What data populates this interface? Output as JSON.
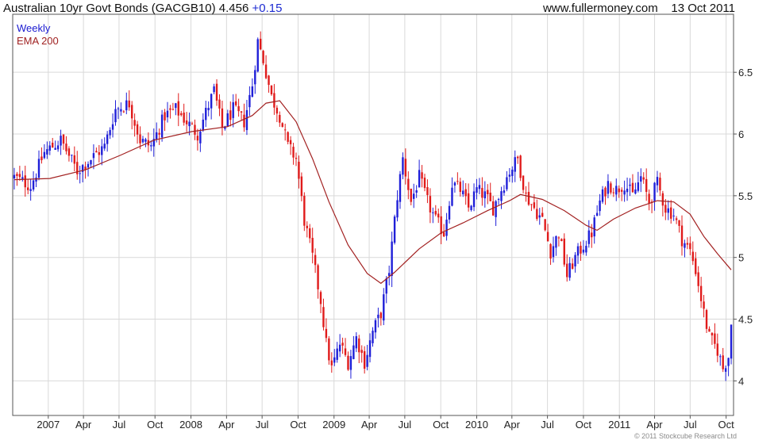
{
  "header": {
    "instrument": "Australian 10yr Govt Bonds (GACGB10)",
    "last": "4.456",
    "change": "+0.15",
    "source": "www.fullermoney.com",
    "date": "13 Oct 2011"
  },
  "legend": {
    "period": "Weekly",
    "ema": "EMA 200"
  },
  "copyright": "© 2011 Stockcube Research Ltd",
  "colors": {
    "up": "#1f1fd8",
    "down": "#e01b1b",
    "ema": "#a22020",
    "grid": "#d9d9d9",
    "frame": "#555555"
  },
  "chart_data": {
    "type": "candlestick",
    "period": "weekly",
    "y_ticks": [
      "4",
      "4.5",
      "5",
      "5.5",
      "6",
      "6.5"
    ],
    "ylim": [
      3.72,
      6.97
    ],
    "x_range": [
      "2006-10-02",
      "2011-10-20"
    ],
    "x_ticks": [
      {
        "date": "2007-01-01",
        "label": "2007"
      },
      {
        "date": "2007-04-01",
        "label": "Apr"
      },
      {
        "date": "2007-07-01",
        "label": "Jul"
      },
      {
        "date": "2007-10-01",
        "label": "Oct"
      },
      {
        "date": "2008-01-01",
        "label": "2008"
      },
      {
        "date": "2008-04-01",
        "label": "Apr"
      },
      {
        "date": "2008-07-01",
        "label": "Jul"
      },
      {
        "date": "2008-10-01",
        "label": "Oct"
      },
      {
        "date": "2009-01-01",
        "label": "2009"
      },
      {
        "date": "2009-04-01",
        "label": "Apr"
      },
      {
        "date": "2009-07-01",
        "label": "Jul"
      },
      {
        "date": "2009-10-01",
        "label": "Oct"
      },
      {
        "date": "2010-01-01",
        "label": "2010"
      },
      {
        "date": "2010-04-01",
        "label": "Apr"
      },
      {
        "date": "2010-07-01",
        "label": "Jul"
      },
      {
        "date": "2010-10-01",
        "label": "Oct"
      },
      {
        "date": "2011-01-01",
        "label": "2011"
      },
      {
        "date": "2011-04-01",
        "label": "Apr"
      },
      {
        "date": "2011-07-01",
        "label": "Jul"
      },
      {
        "date": "2011-10-01",
        "label": "Oct"
      }
    ],
    "close_path": [
      [
        "2006-10-06",
        5.65
      ],
      [
        "2006-11-17",
        5.58
      ],
      [
        "2006-12-22",
        5.85
      ],
      [
        "2007-02-02",
        5.95
      ],
      [
        "2007-03-16",
        5.7
      ],
      [
        "2007-04-20",
        5.8
      ],
      [
        "2007-05-25",
        5.9
      ],
      [
        "2007-06-22",
        6.2
      ],
      [
        "2007-07-27",
        6.25
      ],
      [
        "2007-08-24",
        5.95
      ],
      [
        "2007-09-21",
        5.9
      ],
      [
        "2007-10-26",
        6.15
      ],
      [
        "2007-11-23",
        6.2
      ],
      [
        "2007-12-21",
        6.1
      ],
      [
        "2008-01-18",
        6.0
      ],
      [
        "2008-02-29",
        6.35
      ],
      [
        "2008-03-21",
        6.05
      ],
      [
        "2008-04-18",
        6.2
      ],
      [
        "2008-05-16",
        6.1
      ],
      [
        "2008-06-06",
        6.4
      ],
      [
        "2008-06-20",
        6.75
      ],
      [
        "2008-07-04",
        6.6
      ],
      [
        "2008-07-25",
        6.3
      ],
      [
        "2008-08-15",
        6.15
      ],
      [
        "2008-09-05",
        5.9
      ],
      [
        "2008-09-26",
        5.8
      ],
      [
        "2008-10-17",
        5.3
      ],
      [
        "2008-11-07",
        5.0
      ],
      [
        "2008-11-28",
        4.65
      ],
      [
        "2008-12-12",
        4.3
      ],
      [
        "2008-12-26",
        4.1
      ],
      [
        "2009-01-16",
        4.3
      ],
      [
        "2009-02-06",
        4.15
      ],
      [
        "2009-02-27",
        4.35
      ],
      [
        "2009-03-20",
        4.15
      ],
      [
        "2009-04-10",
        4.4
      ],
      [
        "2009-05-01",
        4.55
      ],
      [
        "2009-05-22",
        4.9
      ],
      [
        "2009-06-12",
        5.5
      ],
      [
        "2009-06-26",
        5.8
      ],
      [
        "2009-07-17",
        5.45
      ],
      [
        "2009-08-07",
        5.65
      ],
      [
        "2009-08-28",
        5.45
      ],
      [
        "2009-09-18",
        5.3
      ],
      [
        "2009-10-09",
        5.2
      ],
      [
        "2009-10-30",
        5.6
      ],
      [
        "2009-11-20",
        5.55
      ],
      [
        "2009-12-11",
        5.4
      ],
      [
        "2010-01-01",
        5.55
      ],
      [
        "2010-01-22",
        5.5
      ],
      [
        "2010-02-12",
        5.4
      ],
      [
        "2010-03-05",
        5.55
      ],
      [
        "2010-03-26",
        5.7
      ],
      [
        "2010-04-16",
        5.8
      ],
      [
        "2010-05-07",
        5.5
      ],
      [
        "2010-05-28",
        5.4
      ],
      [
        "2010-06-18",
        5.3
      ],
      [
        "2010-07-09",
        5.05
      ],
      [
        "2010-07-30",
        5.2
      ],
      [
        "2010-08-20",
        4.85
      ],
      [
        "2010-09-10",
        5.0
      ],
      [
        "2010-10-01",
        5.1
      ],
      [
        "2010-10-22",
        5.2
      ],
      [
        "2010-11-12",
        5.45
      ],
      [
        "2010-12-03",
        5.6
      ],
      [
        "2010-12-24",
        5.55
      ],
      [
        "2011-01-14",
        5.6
      ],
      [
        "2011-02-04",
        5.5
      ],
      [
        "2011-02-25",
        5.65
      ],
      [
        "2011-03-18",
        5.45
      ],
      [
        "2011-04-08",
        5.6
      ],
      [
        "2011-04-29",
        5.4
      ],
      [
        "2011-05-20",
        5.35
      ],
      [
        "2011-06-10",
        5.15
      ],
      [
        "2011-07-01",
        5.05
      ],
      [
        "2011-07-15",
        4.9
      ],
      [
        "2011-08-05",
        4.55
      ],
      [
        "2011-08-19",
        4.35
      ],
      [
        "2011-09-09",
        4.25
      ],
      [
        "2011-09-23",
        4.1
      ],
      [
        "2011-10-07",
        4.2
      ],
      [
        "2011-10-14",
        4.456
      ]
    ],
    "ema_path": [
      [
        "2006-10-06",
        5.63
      ],
      [
        "2007-01-05",
        5.64
      ],
      [
        "2007-04-06",
        5.71
      ],
      [
        "2007-07-06",
        5.83
      ],
      [
        "2007-09-28",
        5.95
      ],
      [
        "2008-01-04",
        6.02
      ],
      [
        "2008-04-04",
        6.06
      ],
      [
        "2008-06-06",
        6.15
      ],
      [
        "2008-07-11",
        6.25
      ],
      [
        "2008-08-15",
        6.27
      ],
      [
        "2008-09-26",
        6.1
      ],
      [
        "2008-11-07",
        5.8
      ],
      [
        "2008-12-19",
        5.45
      ],
      [
        "2009-02-06",
        5.1
      ],
      [
        "2009-03-27",
        4.87
      ],
      [
        "2009-05-01",
        4.79
      ],
      [
        "2009-06-05",
        4.88
      ],
      [
        "2009-08-07",
        5.07
      ],
      [
        "2009-10-02",
        5.2
      ],
      [
        "2009-11-27",
        5.28
      ],
      [
        "2010-01-29",
        5.38
      ],
      [
        "2010-03-26",
        5.46
      ],
      [
        "2010-04-23",
        5.51
      ],
      [
        "2010-06-18",
        5.47
      ],
      [
        "2010-08-13",
        5.38
      ],
      [
        "2010-10-08",
        5.26
      ],
      [
        "2010-11-05",
        5.22
      ],
      [
        "2010-12-17",
        5.31
      ],
      [
        "2011-02-11",
        5.4
      ],
      [
        "2011-04-08",
        5.46
      ],
      [
        "2011-05-20",
        5.45
      ],
      [
        "2011-07-01",
        5.35
      ],
      [
        "2011-08-05",
        5.17
      ],
      [
        "2011-09-09",
        5.03
      ],
      [
        "2011-10-14",
        4.9
      ]
    ],
    "series": [
      {
        "name": "Weekly",
        "kind": "candlestick"
      },
      {
        "name": "EMA 200",
        "kind": "line"
      }
    ]
  }
}
